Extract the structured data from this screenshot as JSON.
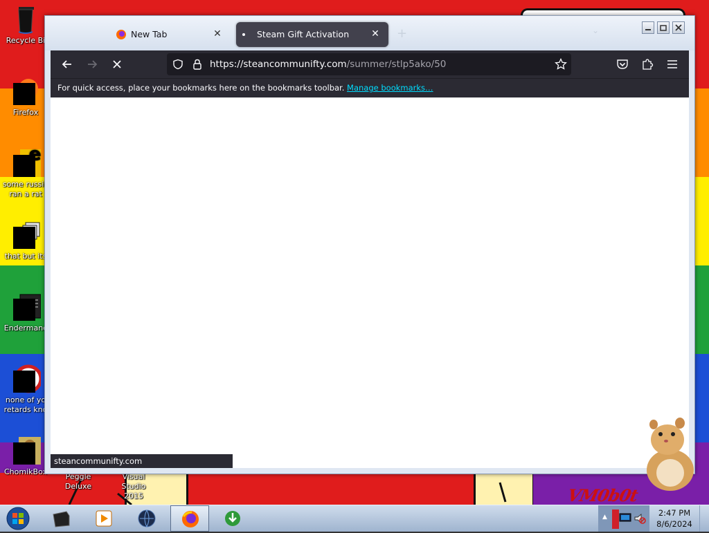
{
  "desktop": {
    "icons": [
      {
        "label": "Recycle Bi"
      },
      {
        "label": "Firefox"
      },
      {
        "label": "some russia\nran a rat"
      },
      {
        "label": "that but its"
      },
      {
        "label": "Endermanc"
      },
      {
        "label": "none of yo\nretards kno"
      },
      {
        "label": "ChomikBox"
      },
      {
        "label": "Peggle Deluxe"
      },
      {
        "label": "Visual Studio\n2015"
      }
    ],
    "watermark": "VM0b0t"
  },
  "browser": {
    "tabs": [
      {
        "title": "New Tab",
        "icon": "firefox-icon",
        "active": false
      },
      {
        "title": "Steam Gift Activation",
        "icon": "loading-dot",
        "active": true
      }
    ],
    "url": {
      "host": "https://steancommunifty.com",
      "path": "/summer/stlp5ako/50"
    },
    "bookmarks_bar": {
      "message": "For quick access, place your bookmarks here on the bookmarks toolbar.",
      "link": "Manage bookmarks…"
    },
    "status_text": "steancommunifty.com"
  },
  "taskbar": {
    "clock": {
      "time": "2:47 PM",
      "date": "8/6/2024"
    }
  },
  "colors": {
    "toolbar": "#2b2a33",
    "urlbar": "#1c1b22",
    "link": "#00ddff",
    "tab_active": "#42414d"
  }
}
